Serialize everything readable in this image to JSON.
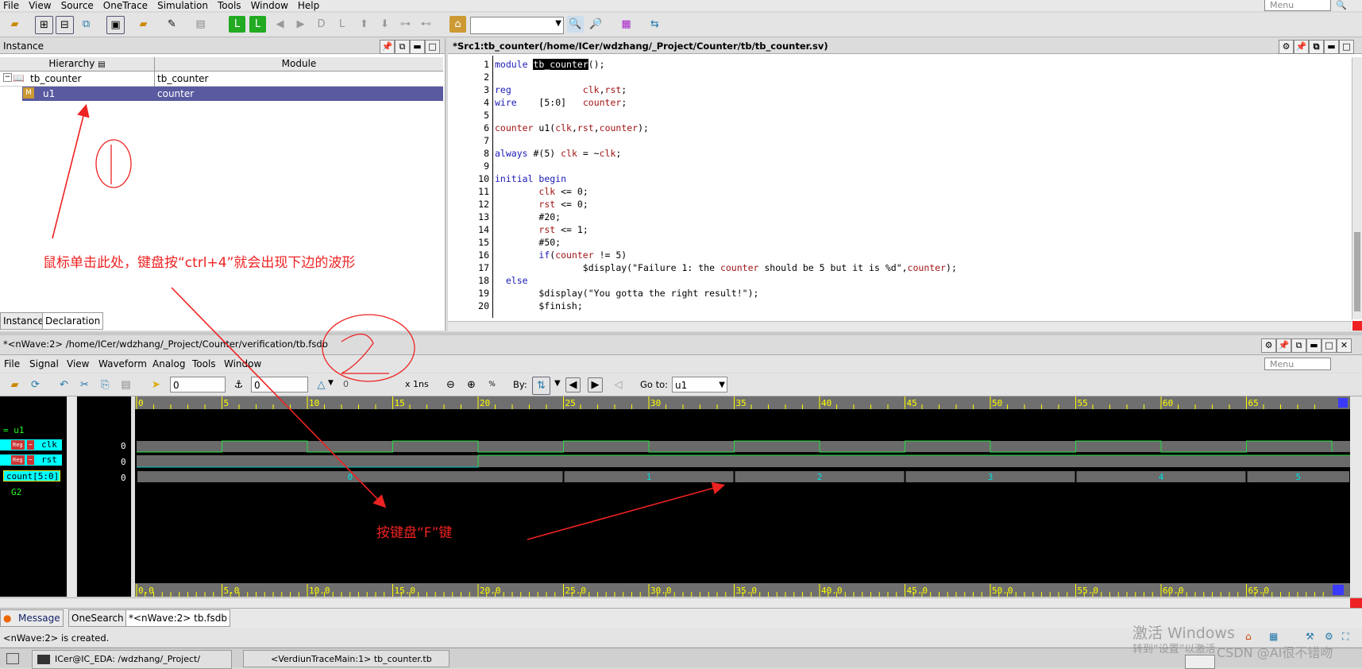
{
  "menubar": {
    "items": [
      "File",
      "View",
      "Source",
      "OneTrace",
      "Simulation",
      "Tools",
      "Window",
      "Help"
    ],
    "menu_placeholder": "Menu"
  },
  "instance_panel": {
    "title": "Instance",
    "col_hierarchy": "Hierarchy",
    "col_module": "Module",
    "rows": [
      {
        "name": "tb_counter",
        "module": "tb_counter"
      },
      {
        "name": "u1",
        "module": "counter"
      }
    ],
    "tabs": [
      "Instance",
      "Declaration"
    ]
  },
  "source_panel": {
    "title": "*Src1:tb_counter(/home/ICer/wdzhang/_Project/Counter/tb/tb_counter.sv)",
    "lines": [
      {
        "n": "1",
        "t": "module tb_counter();"
      },
      {
        "n": "2",
        "t": ""
      },
      {
        "n": "3",
        "t": "reg             clk,rst;"
      },
      {
        "n": "4",
        "t": "wire    [5:0]   counter;"
      },
      {
        "n": "5",
        "t": ""
      },
      {
        "n": "6",
        "t": "counter u1(clk,rst,counter);"
      },
      {
        "n": "7",
        "t": ""
      },
      {
        "n": "8",
        "t": "always #(5) clk = ~clk;"
      },
      {
        "n": "9",
        "t": ""
      },
      {
        "n": "10",
        "t": "initial begin"
      },
      {
        "n": "11",
        "t": "        clk <= 0;"
      },
      {
        "n": "12",
        "t": "        rst <= 0;"
      },
      {
        "n": "13",
        "t": "        #20;"
      },
      {
        "n": "14",
        "t": "        rst <= 1;"
      },
      {
        "n": "15",
        "t": "        #50;"
      },
      {
        "n": "16",
        "t": "        if(counter != 5)"
      },
      {
        "n": "17",
        "t": "                $display(\"Failure 1: the counter should be 5 but it is %d\",counter);"
      },
      {
        "n": "18",
        "t": "  else"
      },
      {
        "n": "19",
        "t": "        $display(\"You gotta the right result!\");"
      },
      {
        "n": "20",
        "t": "        $finish;"
      }
    ]
  },
  "nwave": {
    "title": "*<nWave:2> /home/ICer/wdzhang/_Project/Counter/verification/tb.fsdb",
    "menu": [
      "File",
      "Signal",
      "View",
      "Waveform",
      "Analog",
      "Tools",
      "Window"
    ],
    "menu_placeholder": "Menu",
    "cursor_value": "0",
    "marker_value": "0",
    "delta_value": "0",
    "time_unit": "x 1ns",
    "by_label": "By:",
    "goto_label": "Go to:",
    "goto_value": "u1",
    "group_label": "= u1",
    "signals": [
      {
        "name": "clk",
        "value": "0"
      },
      {
        "name": "rst",
        "value": "0"
      },
      {
        "name": "count[5:0]",
        "value": "0"
      }
    ],
    "group2": "G2",
    "ruler_labels": [
      "0",
      "5",
      "10",
      "15",
      "20",
      "25",
      "30",
      "35",
      "40",
      "45",
      "50",
      "55",
      "60",
      "65"
    ],
    "bottom_ruler_labels": [
      "0.0",
      "5.0",
      "10.0",
      "15.0",
      "20.0",
      "25.0",
      "30.0",
      "35.0",
      "40.0",
      "45.0",
      "50.0",
      "55.0",
      "60.0",
      "65.0"
    ],
    "count_values": [
      "0",
      "1",
      "2",
      "3",
      "4",
      "5"
    ]
  },
  "bottom_tabs": [
    "Message",
    "OneSearch",
    "*<nWave:2> tb.fsdb"
  ],
  "status_text": "<nWave:2> is created.",
  "taskbar": [
    "ICer@IC_EDA: /wdzhang/_Project/",
    "<VerdiunTraceMain:1> tb_counter.tb"
  ],
  "annotations": {
    "text1": "鼠标单击此处，键盘按“ctrl+4”就会出现下边的波形",
    "text2": "按键盘“F”键",
    "circle1": "1",
    "circle2": "2"
  },
  "watermark": {
    "windows": "激活 Windows",
    "windows_sub": "转到“设置”以激活",
    "csdn": "CSDN @AI很不错吻"
  },
  "colors": {
    "accent": "#6a6aa8",
    "wave_green": "#22dd44",
    "wave_cyan": "#00c8c8",
    "annotation": "#e22222",
    "highlight_row": "#5a5aa0"
  }
}
